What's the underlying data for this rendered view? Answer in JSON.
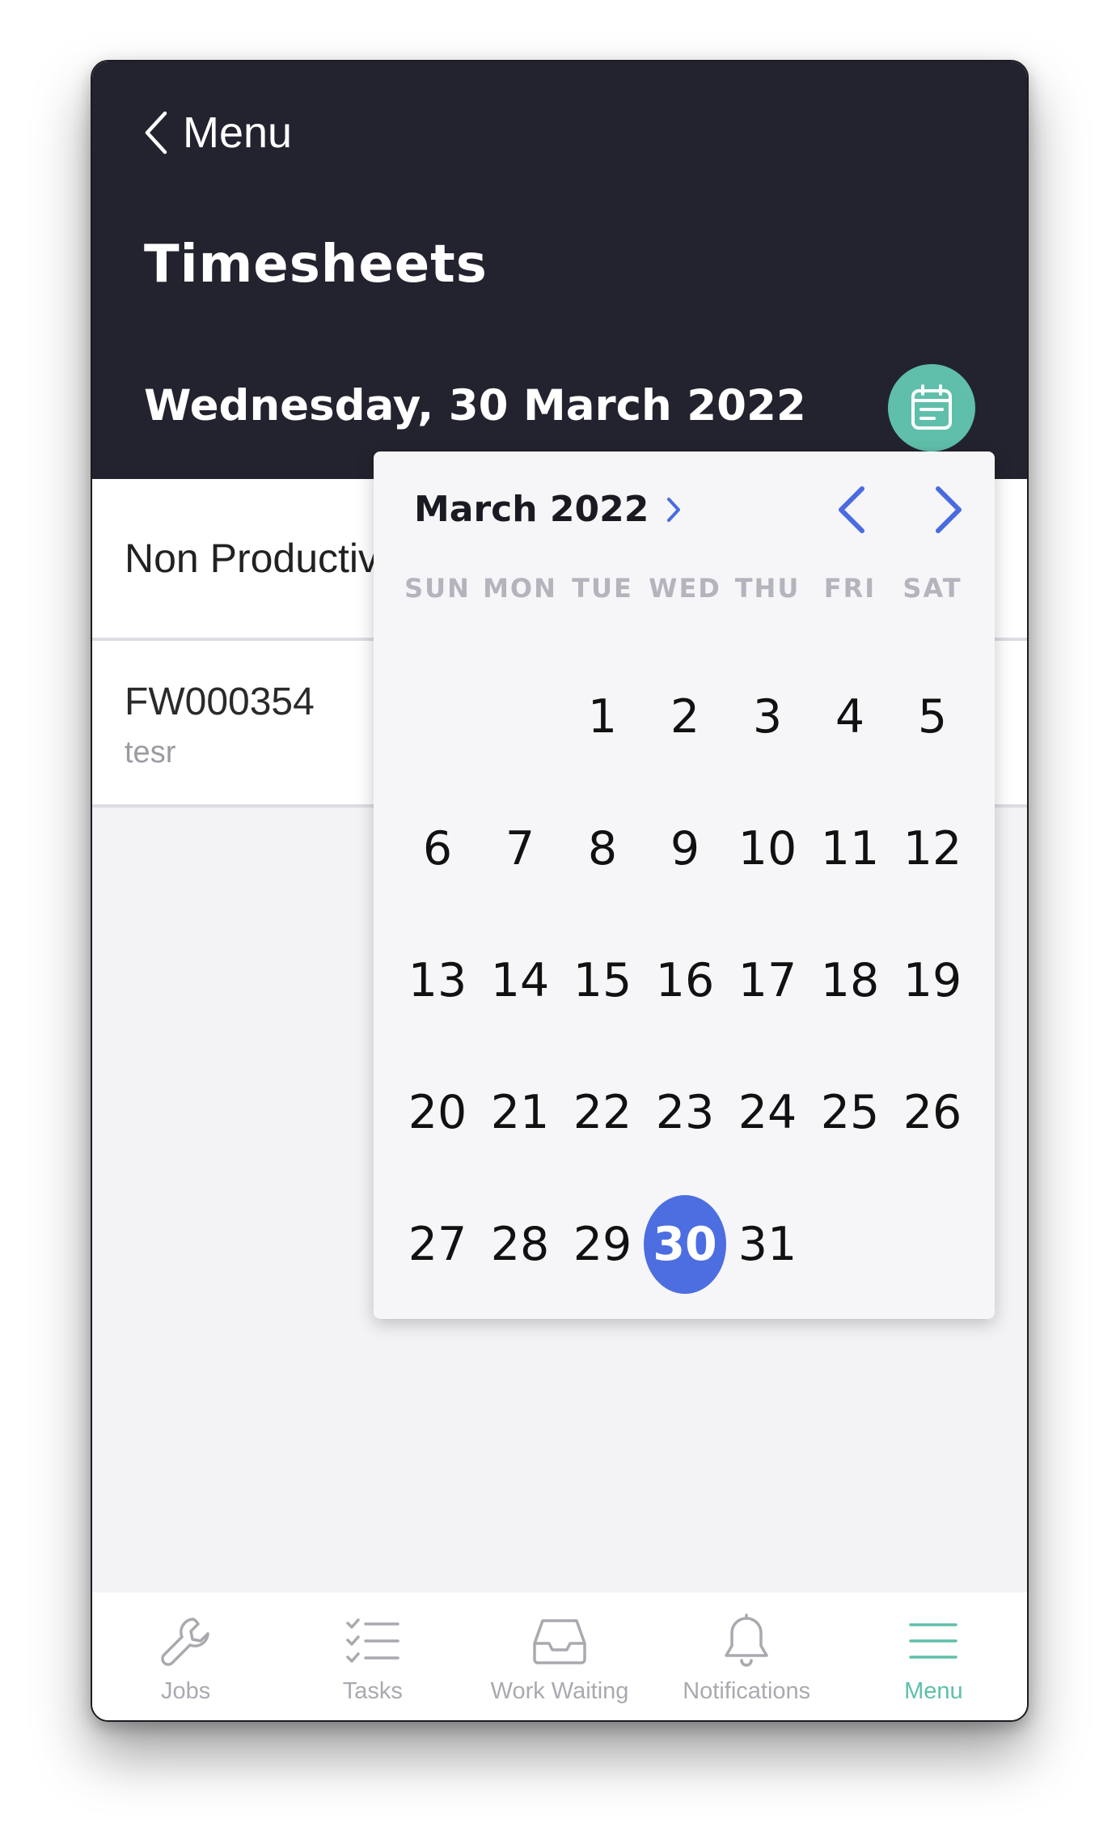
{
  "header": {
    "back_label": "Menu",
    "title": "Timesheets",
    "selected_date": "Wednesday, 30 March 2022"
  },
  "list": {
    "non_productive_label": "Non Productive",
    "job": {
      "id": "FW000354",
      "subtitle": "tesr"
    }
  },
  "picker": {
    "month_label": "March 2022",
    "weekdays": [
      "SUN",
      "MON",
      "TUE",
      "WED",
      "THU",
      "FRI",
      "SAT"
    ],
    "weeks": [
      [
        "",
        "",
        "1",
        "2",
        "3",
        "4",
        "5"
      ],
      [
        "6",
        "7",
        "8",
        "9",
        "10",
        "11",
        "12"
      ],
      [
        "13",
        "14",
        "15",
        "16",
        "17",
        "18",
        "19"
      ],
      [
        "20",
        "21",
        "22",
        "23",
        "24",
        "25",
        "26"
      ],
      [
        "27",
        "28",
        "29",
        "30",
        "31",
        "",
        ""
      ]
    ],
    "selected_day": "30"
  },
  "tabs": [
    {
      "label": "Jobs",
      "icon": "wrench-icon"
    },
    {
      "label": "Tasks",
      "icon": "checklist-icon"
    },
    {
      "label": "Work Waiting",
      "icon": "inbox-tray-icon"
    },
    {
      "label": "Notifications",
      "icon": "bell-icon"
    },
    {
      "label": "Menu",
      "icon": "menu-lines-icon",
      "active": true
    }
  ],
  "colors": {
    "header_bg": "#23232f",
    "accent_teal": "#5fbfaa",
    "selected_blue": "#4c6ee0",
    "nav_blue": "#4a6be0"
  }
}
